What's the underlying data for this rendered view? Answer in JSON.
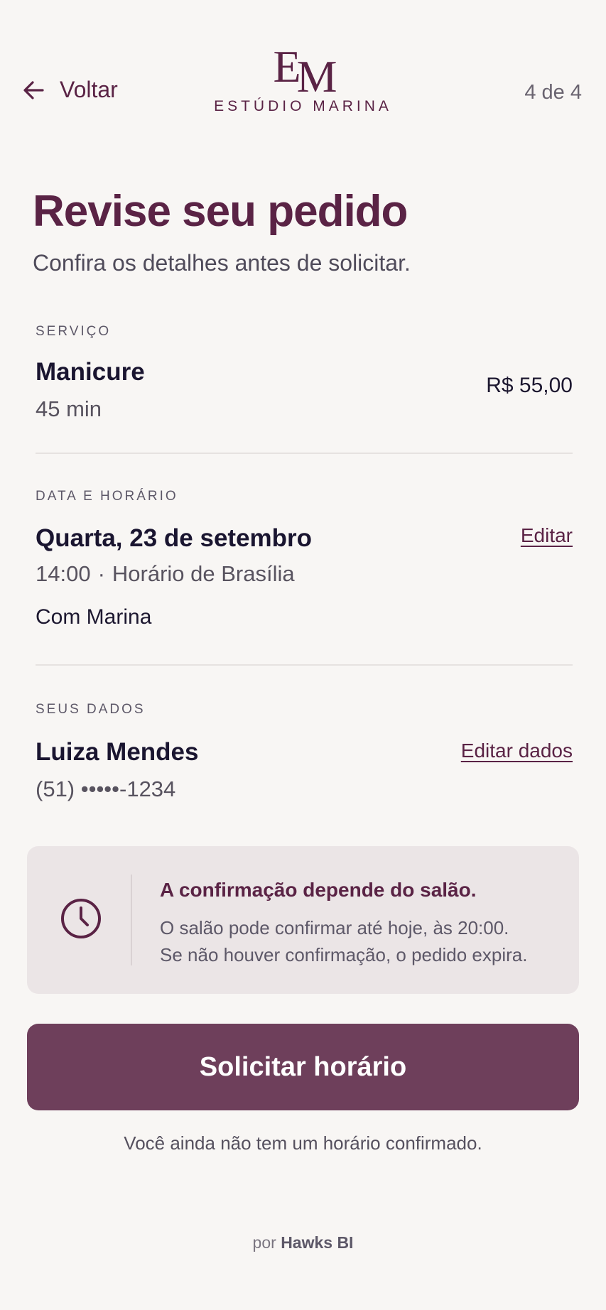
{
  "header": {
    "back_label": "Voltar",
    "logo_mark_e": "E",
    "logo_mark_m": "M",
    "logo_text": "ESTÚDIO MARINA",
    "step": "4 de 4"
  },
  "page": {
    "title": "Revise seu pedido",
    "subtitle": "Confira os detalhes antes de solicitar."
  },
  "service": {
    "label": "SERVIÇO",
    "name": "Manicure",
    "duration": "45 min",
    "price": "R$ 55,00"
  },
  "schedule": {
    "label": "DATA E HORÁRIO",
    "date": "Quarta, 23 de setembro",
    "time": "14:00",
    "separator": "·",
    "timezone": "Horário de Brasília",
    "professional": "Com Marina",
    "edit_label": "Editar"
  },
  "customer": {
    "label": "SEUS DADOS",
    "name": "Luiza Mendes",
    "phone": "(51) •••••-1234",
    "edit_label": "Editar dados"
  },
  "notice": {
    "icon": "clock-icon",
    "title": "A confirmação depende do salão.",
    "line1": "O salão pode confirmar até hoje, às 20:00.",
    "line2": "Se não houver confirmação, o pedido expira."
  },
  "cta": {
    "label": "Solicitar horário",
    "note": "Você ainda não tem um horário confirmado."
  },
  "footer": {
    "prefix": "por",
    "brand": "Hawks BI"
  },
  "colors": {
    "brand": "#5a2345",
    "button": "#6e3f5b",
    "background": "#f8f6f4",
    "notice_bg": "#ebe5e6"
  }
}
